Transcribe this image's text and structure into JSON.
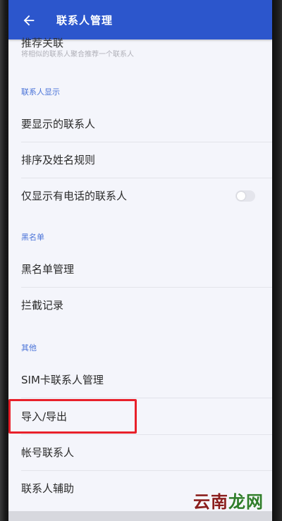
{
  "appbar": {
    "title": "联系人管理",
    "back_icon": "arrow-left-icon"
  },
  "partial_item": {
    "title": "推荐关联",
    "subtitle": "将相似的联系人聚合推荐一个联系人"
  },
  "sections": [
    {
      "header": "联系人显示",
      "items": [
        "要显示的联系人",
        "排序及姓名规则",
        "仅显示有电话的联系人"
      ]
    },
    {
      "header": "黑名单",
      "items": [
        "黑名单管理",
        "拦截记录"
      ]
    },
    {
      "header": "其他",
      "items": [
        "SIM卡联系人管理",
        "导入/导出",
        "帐号联系人",
        "联系人辅助"
      ]
    }
  ],
  "toggle": {
    "state": "off"
  },
  "watermark": {
    "text_a": "云南",
    "text_b": "龙网"
  },
  "colors": {
    "appbar": "#2c56cc",
    "section_header": "#4a73d8",
    "highlight": "#e8202a"
  }
}
